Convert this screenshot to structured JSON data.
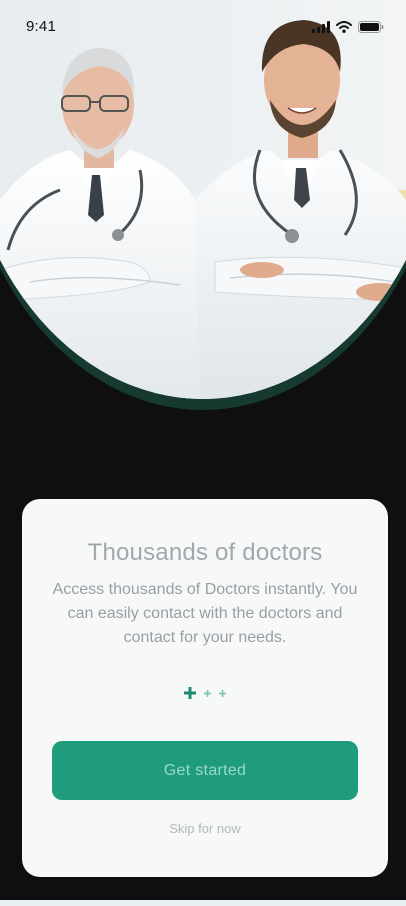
{
  "status_bar": {
    "time": "9:41",
    "icons": [
      "signal-icon",
      "wifi-icon",
      "battery-icon"
    ]
  },
  "hero": {
    "image_subject": "two-doctors-photo"
  },
  "onboarding": {
    "title": "Thousands of doctors",
    "description": "Access thousands of Doctors instantly. You can easily contact with the doctors and contact for your needs.",
    "page_indicator": {
      "total": 3,
      "current": 1
    },
    "primary_button_label": "Get started",
    "skip_label": "Skip for now"
  },
  "colors": {
    "accent": "#1f9c7c",
    "background": "#0f0e10",
    "card": "#f7f9f9",
    "hero_rim": "#163a30"
  }
}
